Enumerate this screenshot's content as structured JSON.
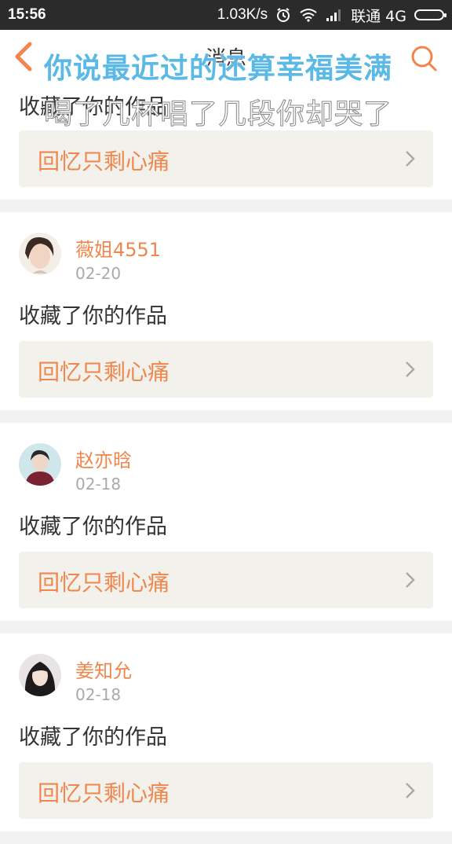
{
  "status_bar": {
    "time": "15:56",
    "net_speed": "1.03K/s",
    "carrier": "联通 4G"
  },
  "nav": {
    "title": "消息",
    "back_icon": "back-chevron-icon",
    "search_icon": "search-icon"
  },
  "lyrics": {
    "line1": "你说最近过的还算幸福美满",
    "line2": "喝了几杯唱了几段你却哭了"
  },
  "colors": {
    "accent": "#f0864c",
    "lyric_blue": "#5ab9e6"
  },
  "notifications": [
    {
      "user": "",
      "date": "",
      "action": "收藏了你的作品",
      "work": "回忆只剩心痛"
    },
    {
      "user": "薇姐4551",
      "date": "02-20",
      "action": "收藏了你的作品",
      "work": "回忆只剩心痛"
    },
    {
      "user": "赵亦晗",
      "date": "02-18",
      "action": "收藏了你的作品",
      "work": "回忆只剩心痛"
    },
    {
      "user": "姜知允",
      "date": "02-18",
      "action": "收藏了你的作品",
      "work": "回忆只剩心痛"
    }
  ]
}
